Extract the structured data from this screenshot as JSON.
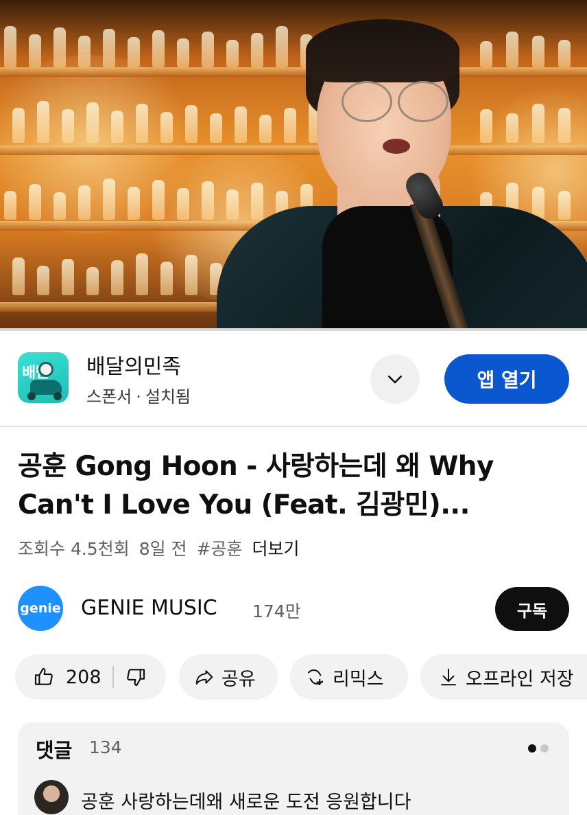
{
  "video": {
    "progress_fraction": 0.0
  },
  "ad": {
    "app_name": "배달의민족",
    "icon_text": "배민",
    "sponsor_label": "스폰서",
    "separator": "·",
    "status": "설치됨",
    "expand_icon": "chevron-down-icon",
    "open_button": "앱 열기",
    "accent_color": "#0b57d0"
  },
  "title": "공훈 Gong Hoon - 사랑하는데 왜 Why Can't I Love You (Feat. 김광민)...",
  "meta": {
    "views": "조회수 4.5천회",
    "age": "8일 전",
    "hashtag": "#공훈",
    "more": "더보기"
  },
  "channel": {
    "avatar_text": "genie",
    "name": "GENIE MUSIC",
    "subscribers": "174만",
    "subscribe_button": "구독"
  },
  "actions": {
    "like_count": "208",
    "like_icon": "thumbs-up-icon",
    "dislike_icon": "thumbs-down-icon",
    "share_label": "공유",
    "share_icon": "share-icon",
    "remix_label": "리믹스",
    "remix_icon": "remix-icon",
    "offline_label": "오프라인 저장",
    "offline_icon": "download-icon"
  },
  "comments": {
    "heading": "댓글",
    "count": "134",
    "top_comment": "공훈 사랑하는데왜 새로운 도전  응원합니다"
  }
}
